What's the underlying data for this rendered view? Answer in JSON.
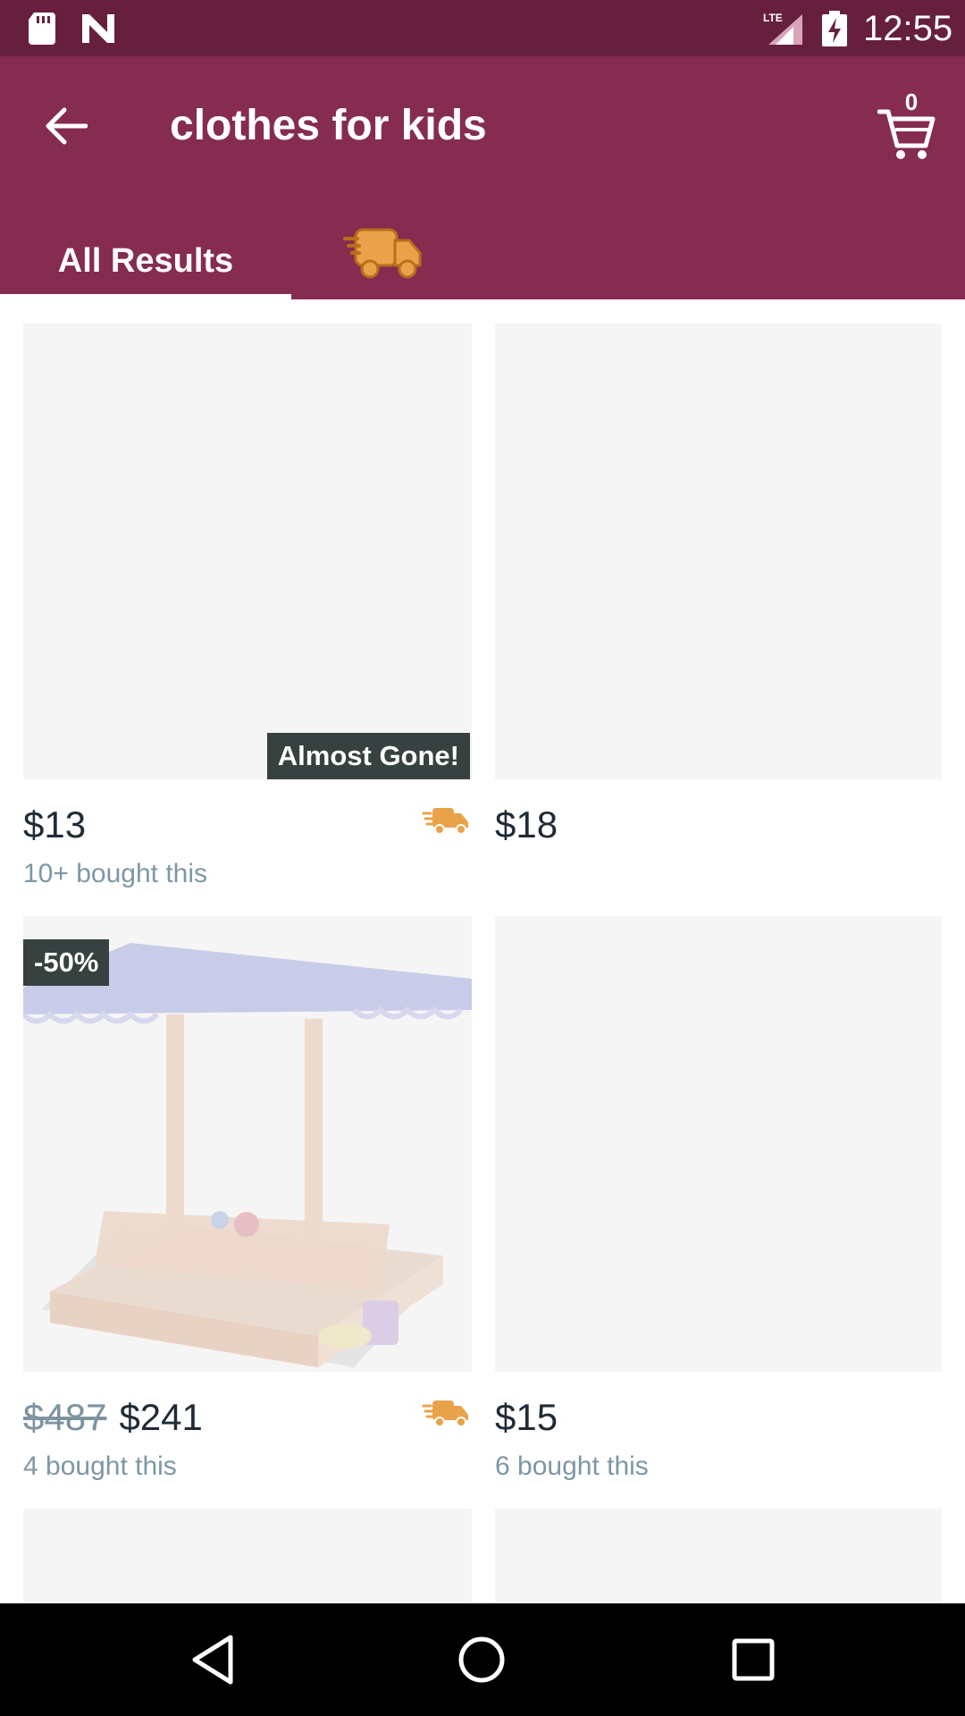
{
  "status_bar": {
    "time": "12:55",
    "network": "LTE",
    "icons": [
      "sd-card-icon",
      "n-notification-icon",
      "lte-signal-icon",
      "battery-charging-icon"
    ]
  },
  "header": {
    "title": "clothes for kids",
    "cart_count": "0",
    "icons": [
      "back-arrow-icon",
      "cart-icon"
    ]
  },
  "tabs": [
    {
      "label": "All Results",
      "selected": true
    },
    {
      "label": "",
      "icon": "fast-delivery-truck-icon",
      "selected": false
    }
  ],
  "colors": {
    "status_bar": "#66203d",
    "app_bar": "#852c50",
    "accent_truck": "#e9a24a",
    "badge_bg": "#364140",
    "placeholder": "#f5f5f5"
  },
  "products": [
    {
      "badge": "Almost Gone!",
      "price": "$13",
      "bought": "10+ bought this",
      "fast_delivery": true
    },
    {
      "price": "$18",
      "bought": "",
      "fast_delivery": false
    },
    {
      "badge": "-50%",
      "old_price": "$487",
      "price": "$241",
      "bought": "4 bought this",
      "fast_delivery": true,
      "image": "wooden sandbox with blue canopy"
    },
    {
      "price": "$15",
      "bought": "6 bought this",
      "fast_delivery": false
    }
  ],
  "nav_bar": {
    "icons": [
      "nav-back-icon",
      "nav-home-icon",
      "nav-recent-apps-icon"
    ]
  }
}
